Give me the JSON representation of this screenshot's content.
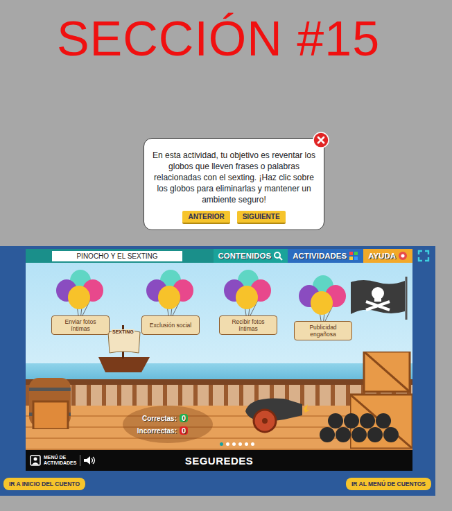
{
  "section_title": "SECCIÓN #15",
  "dialog": {
    "text": "En esta actividad, tu objetivo es reventar los globos que lleven frases o palabras relacionadas con el sexting. ¡Haz clic sobre los globos para eliminarlas y mantener un ambiente seguro!",
    "buttons": [
      {
        "label": "ANTERIOR"
      },
      {
        "label": "SIGUIENTE"
      }
    ]
  },
  "game": {
    "title": "PINOCHO Y EL SEXTING",
    "nav": [
      {
        "label": "CONTENIDOS"
      },
      {
        "label": "ACTIVIDADES"
      },
      {
        "label": "AYUDA"
      }
    ],
    "balloons": [
      {
        "label": "Enviar fotos íntimas"
      },
      {
        "label": "Exclusión social"
      },
      {
        "label": "Recibir fotos íntimas"
      },
      {
        "label": "Publicidad engañosa"
      }
    ],
    "ship_label": "SEXTING",
    "score": {
      "correct_label": "Correctas:",
      "correct": "0",
      "incorrect_label": "Incorrectas:",
      "incorrect": "0"
    },
    "pages": [
      {
        "selected": true
      },
      {
        "selected": false
      },
      {
        "selected": false
      },
      {
        "selected": false
      },
      {
        "selected": false
      },
      {
        "selected": false
      }
    ],
    "menu_label": "MENÚ DE ACTIVIDADES",
    "logo": "SEGUREDES"
  },
  "bottom_buttons": [
    {
      "label": "IR A INICIO DEL CUENTO"
    },
    {
      "label": "IR AL MENÚ DE CUENTOS"
    }
  ]
}
